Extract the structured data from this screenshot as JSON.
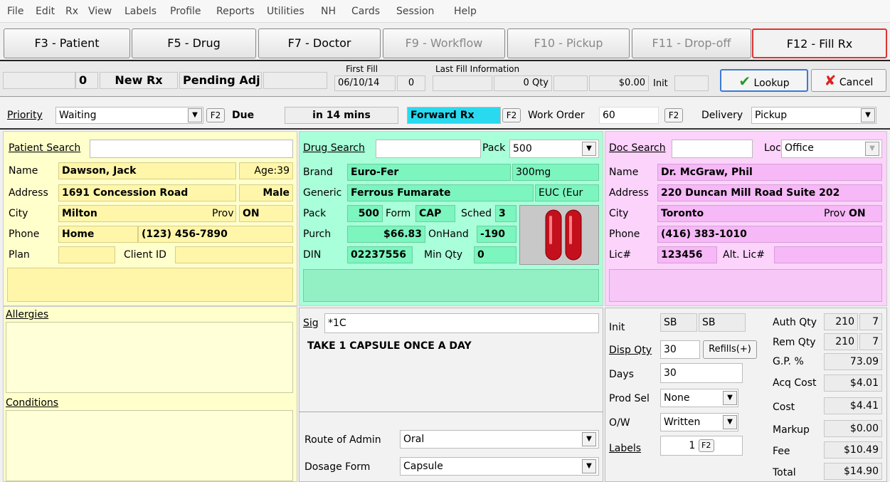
{
  "menu": [
    "File",
    "Edit",
    "Rx",
    "View",
    "Labels",
    "Profile",
    "Reports",
    "Utilities",
    "NH",
    "Cards",
    "Session",
    "Help"
  ],
  "fkeys": {
    "patient": "F3 - Patient",
    "drug": "F5 - Drug",
    "doctor": "F7 - Doctor",
    "workflow": "F9 - Workflow",
    "pickup": "F10 - Pickup",
    "dropoff": "F11 - Drop-off",
    "fill": "F12 - Fill Rx"
  },
  "status": {
    "count": "0",
    "newrx": "New Rx",
    "pending": "Pending Adj",
    "first_fill_label": "First Fill",
    "first_fill_date": "06/10/14",
    "first_fill_num": "0",
    "last_fill_label": "Last Fill Information",
    "last_qty_num": "0",
    "qty_label": "Qty",
    "amount": "$0.00",
    "init_label": "Init",
    "lookup": "Lookup",
    "cancel": "Cancel"
  },
  "toolbar": {
    "priority_label": "Priority",
    "priority_value": "Waiting",
    "f2": "F2",
    "due_label": "Due",
    "due_value": "in 14 mins",
    "forward": "Forward Rx",
    "work_order_label": "Work Order",
    "work_order_value": "60",
    "delivery_label": "Delivery",
    "delivery_value": "Pickup"
  },
  "patient": {
    "search_label": "Patient Search",
    "name_label": "Name",
    "name": "Dawson, Jack",
    "age": "Age:39",
    "address_label": "Address",
    "address": "1691 Concession Road",
    "sex": "Male",
    "city_label": "City",
    "city": "Milton",
    "prov_label": "Prov",
    "prov": "ON",
    "phone_label": "Phone",
    "phone_type": "Home",
    "phone": "(123) 456-7890",
    "plan_label": "Plan",
    "client_label": "Client ID",
    "allergies": "Allergies",
    "conditions": "Conditions"
  },
  "drug": {
    "search_label": "Drug Search",
    "pack_label": "Pack",
    "pack_value": "500",
    "brand_label": "Brand",
    "brand": "Euro-Fer",
    "strength": "300mg",
    "generic_label": "Generic",
    "generic": "Ferrous Fumarate",
    "euc": "EUC (Eur",
    "pack2_label": "Pack",
    "pack2": "500",
    "form_label": "Form",
    "form": "CAP",
    "sched_label": "Sched",
    "sched": "3",
    "purch_label": "Purch",
    "purch": "$66.83",
    "onhand_label": "OnHand",
    "onhand": "-190",
    "din_label": "DIN",
    "din": "02237556",
    "minqty_label": "Min Qty",
    "minqty": "0"
  },
  "doctor": {
    "search_label": "Doc Search",
    "loc_label": "Loc",
    "loc_value": "Office",
    "name_label": "Name",
    "name": "Dr. McGraw, Phil",
    "address_label": "Address",
    "address": "220 Duncan Mill Road Suite 202",
    "city_label": "City",
    "city": "Toronto",
    "prov_label": "Prov",
    "prov": "ON",
    "phone_label": "Phone",
    "phone": "(416) 383-1010",
    "lic_label": "Lic#",
    "lic": "123456",
    "altlic_label": "Alt. Lic#"
  },
  "sig": {
    "label": "Sig",
    "code": "*1C",
    "text": "TAKE 1 CAPSULE ONCE A DAY",
    "route_label": "Route of Admin",
    "route": "Oral",
    "dosage_label": "Dosage Form",
    "dosage": "Capsule"
  },
  "rx": {
    "init_label": "Init",
    "init1": "SB",
    "init2": "SB",
    "disp_label": "Disp Qty",
    "disp": "30",
    "refills": "Refills(+)",
    "days_label": "Days",
    "days": "30",
    "prodsel_label": "Prod Sel",
    "prodsel": "None",
    "ow_label": "O/W",
    "ow": "Written",
    "labels_label": "Labels",
    "labels": "1",
    "auth_label": "Auth Qty",
    "auth1": "210",
    "auth2": "7",
    "rem_label": "Rem Qty",
    "rem1": "210",
    "rem2": "7",
    "gp_label": "G.P. %",
    "gp": "73.09",
    "acq_label": "Acq Cost",
    "acq": "$4.01",
    "cost_label": "Cost",
    "cost": "$4.41",
    "markup_label": "Markup",
    "markup": "$0.00",
    "fee_label": "Fee",
    "fee": "$10.49",
    "total_label": "Total",
    "total": "$14.90"
  }
}
